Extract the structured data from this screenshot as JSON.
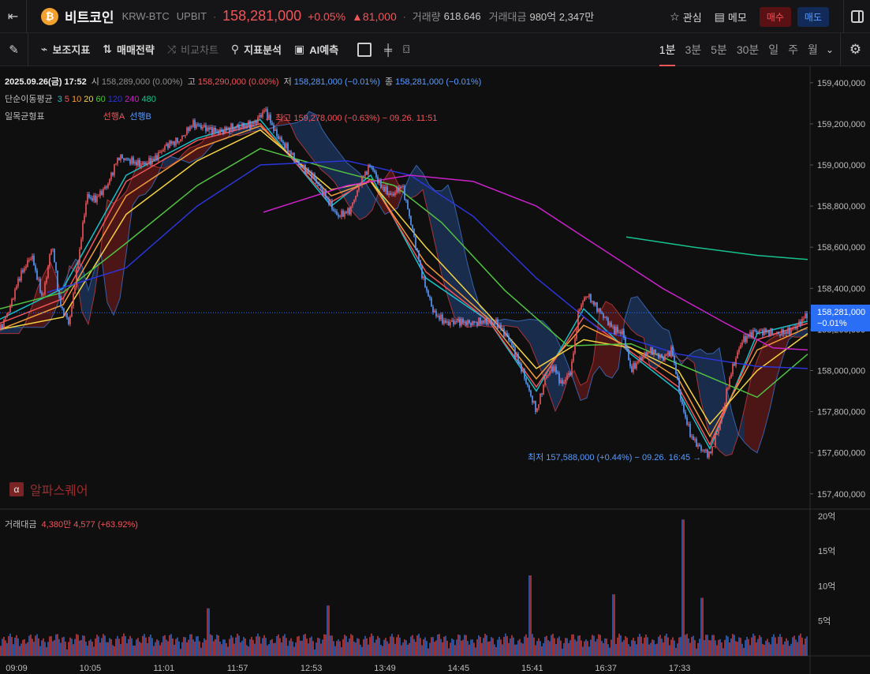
{
  "header": {
    "back_icon": "collapse-left-icon",
    "coin_logo": "₿",
    "coin_name": "비트코인",
    "pair": "KRW-BTC",
    "exchange": "UPBIT",
    "price": "158,281,000",
    "change_pct": "+0.05%",
    "change_amt": "▲81,000",
    "volume_label": "거래량",
    "volume_value": "618.646",
    "trade_value_label": "거래대금",
    "trade_value": "980억 2,347만",
    "watch_label": "관심",
    "memo_label": "메모",
    "buy_label": "매수",
    "sell_label": "매도"
  },
  "toolbar": {
    "indicators": "보조지표",
    "strategy": "매매전략",
    "compare": "비교차트",
    "analysis": "지표분석",
    "ai": "AI예측",
    "intervals": [
      "1분",
      "3분",
      "5분",
      "30분",
      "일",
      "주",
      "월"
    ],
    "active_interval": "1분"
  },
  "info": {
    "date": "2025.09.26(금) 17:52",
    "open_label": "시",
    "open": "158,289,000 (0.00%)",
    "high_label": "고",
    "high": "158,290,000 (0.00%)",
    "low_label": "저",
    "low": "158,281,000 (−0.01%)",
    "close_label": "종",
    "close": "158,281,000 (−0.01%)",
    "sma_label": "단순이동평균",
    "sma_periods": [
      "3",
      "5",
      "10",
      "20",
      "60",
      "120",
      "240",
      "480"
    ],
    "ichimoku_label": "일목균형표",
    "span_a": "선행A",
    "span_b": "선행B",
    "volume_label": "거래대금",
    "volume_text": "4,380만 4,577 (+63.92%)"
  },
  "annotations": {
    "high_text": "← 최고 159,278,000 (−0.63%) − 09.26. 11:51",
    "low_text": "최저 157,588,000 (+0.44%) − 09.26. 16:45 →"
  },
  "current_price_tag": {
    "price": "158,281,000",
    "pct": "−0.01%"
  },
  "watermark": {
    "logo": "α",
    "text": "알파스퀘어"
  },
  "colors": {
    "up": "#f0555a",
    "down": "#5b9bff",
    "sma": [
      "#16c1c9",
      "#f0555a",
      "#f09a3a",
      "#f5d442",
      "#51c241",
      "#2b35d8",
      "#c822c8",
      "#18c28f"
    ]
  },
  "chart_data": {
    "type": "line",
    "title": "",
    "x_ticks": [
      "09:09",
      "10:05",
      "11:01",
      "11:57",
      "12:53",
      "13:49",
      "14:45",
      "15:41",
      "16:37",
      "17:33"
    ],
    "price_ticks": [
      "159,400,000",
      "159,200,000",
      "159,000,000",
      "158,800,000",
      "158,600,000",
      "158,400,000",
      "158,200,000",
      "158,000,000",
      "157,800,000",
      "157,600,000",
      "157,400,000"
    ],
    "volume_ticks": [
      "20억",
      "15억",
      "10억",
      "5억"
    ],
    "ylim": [
      157330000,
      159480000
    ],
    "volume_ylim": [
      0,
      2100000000
    ],
    "price_series": {
      "name": "price",
      "points": [
        [
          0,
          158200000
        ],
        [
          12,
          158300000
        ],
        [
          24,
          158450000
        ],
        [
          40,
          158560000
        ],
        [
          54,
          158350000
        ],
        [
          66,
          158620000
        ],
        [
          76,
          158320000
        ],
        [
          88,
          158230000
        ],
        [
          100,
          158560000
        ],
        [
          110,
          158850000
        ],
        [
          120,
          158830000
        ],
        [
          136,
          158900000
        ],
        [
          150,
          159040000
        ],
        [
          166,
          159020000
        ],
        [
          180,
          159000000
        ],
        [
          196,
          159030000
        ],
        [
          212,
          159100000
        ],
        [
          228,
          159120000
        ],
        [
          244,
          159200000
        ],
        [
          260,
          159180000
        ],
        [
          276,
          159160000
        ],
        [
          292,
          159180000
        ],
        [
          308,
          159190000
        ],
        [
          322,
          159200000
        ],
        [
          336,
          159270000
        ],
        [
          350,
          159150000
        ],
        [
          364,
          159080000
        ],
        [
          380,
          159000000
        ],
        [
          396,
          158950000
        ],
        [
          412,
          158850000
        ],
        [
          428,
          158750000
        ],
        [
          444,
          158780000
        ],
        [
          458,
          158930000
        ],
        [
          470,
          159000000
        ],
        [
          482,
          158900000
        ],
        [
          496,
          158850000
        ],
        [
          510,
          158900000
        ],
        [
          522,
          158700000
        ],
        [
          536,
          158450000
        ],
        [
          550,
          158280000
        ],
        [
          566,
          158230000
        ],
        [
          580,
          158240000
        ],
        [
          596,
          158230000
        ],
        [
          612,
          158240000
        ],
        [
          630,
          158230000
        ],
        [
          646,
          158150000
        ],
        [
          662,
          158000000
        ],
        [
          680,
          157800000
        ],
        [
          692,
          157970000
        ],
        [
          702,
          158020000
        ],
        [
          712,
          157930000
        ],
        [
          724,
          158000000
        ],
        [
          734,
          158300000
        ],
        [
          744,
          158370000
        ],
        [
          756,
          158310000
        ],
        [
          766,
          158260000
        ],
        [
          778,
          158200000
        ],
        [
          790,
          158180000
        ],
        [
          800,
          158000000
        ],
        [
          812,
          158060000
        ],
        [
          826,
          158100000
        ],
        [
          840,
          158060000
        ],
        [
          852,
          158100000
        ],
        [
          864,
          157840000
        ],
        [
          876,
          157680000
        ],
        [
          888,
          157620000
        ],
        [
          900,
          157590000
        ],
        [
          912,
          157730000
        ],
        [
          926,
          157980000
        ],
        [
          940,
          158140000
        ],
        [
          956,
          158190000
        ],
        [
          972,
          158190000
        ],
        [
          986,
          158180000
        ],
        [
          1000,
          158190000
        ],
        [
          1012,
          158220000
        ],
        [
          1024,
          158281000
        ]
      ]
    },
    "sma_series": [
      {
        "name": "3",
        "points": [
          [
            0,
            158250000
          ],
          [
            80,
            158400000
          ],
          [
            160,
            158950000
          ],
          [
            250,
            159130000
          ],
          [
            330,
            159220000
          ],
          [
            420,
            158800000
          ],
          [
            470,
            158950000
          ],
          [
            540,
            158450000
          ],
          [
            620,
            158240000
          ],
          [
            680,
            157900000
          ],
          [
            740,
            158300000
          ],
          [
            800,
            158080000
          ],
          [
            860,
            157900000
          ],
          [
            900,
            157620000
          ],
          [
            960,
            158180000
          ],
          [
            1024,
            158240000
          ]
        ]
      },
      {
        "name": "5",
        "points": [
          [
            0,
            158230000
          ],
          [
            80,
            158350000
          ],
          [
            160,
            158920000
          ],
          [
            250,
            159120000
          ],
          [
            330,
            159200000
          ],
          [
            420,
            158820000
          ],
          [
            470,
            158930000
          ],
          [
            540,
            158480000
          ],
          [
            620,
            158240000
          ],
          [
            680,
            157920000
          ],
          [
            740,
            158260000
          ],
          [
            800,
            158090000
          ],
          [
            860,
            157920000
          ],
          [
            900,
            157640000
          ],
          [
            960,
            158150000
          ],
          [
            1024,
            158230000
          ]
        ]
      },
      {
        "name": "10",
        "points": [
          [
            0,
            158200000
          ],
          [
            80,
            158320000
          ],
          [
            160,
            158850000
          ],
          [
            250,
            159080000
          ],
          [
            330,
            159190000
          ],
          [
            420,
            158850000
          ],
          [
            470,
            158920000
          ],
          [
            540,
            158520000
          ],
          [
            620,
            158250000
          ],
          [
            680,
            157960000
          ],
          [
            740,
            158220000
          ],
          [
            800,
            158110000
          ],
          [
            860,
            157960000
          ],
          [
            900,
            157680000
          ],
          [
            960,
            158100000
          ],
          [
            1024,
            158210000
          ]
        ]
      },
      {
        "name": "20",
        "points": [
          [
            0,
            158200000
          ],
          [
            80,
            158260000
          ],
          [
            160,
            158760000
          ],
          [
            250,
            159020000
          ],
          [
            330,
            159170000
          ],
          [
            420,
            158880000
          ],
          [
            470,
            158920000
          ],
          [
            540,
            158600000
          ],
          [
            620,
            158270000
          ],
          [
            680,
            158010000
          ],
          [
            740,
            158150000
          ],
          [
            800,
            158110000
          ],
          [
            860,
            158000000
          ],
          [
            900,
            157740000
          ],
          [
            960,
            158000000
          ],
          [
            1024,
            158180000
          ]
        ]
      },
      {
        "name": "60",
        "points": [
          [
            0,
            158300000
          ],
          [
            80,
            158380000
          ],
          [
            160,
            158620000
          ],
          [
            250,
            158900000
          ],
          [
            330,
            159080000
          ],
          [
            420,
            158980000
          ],
          [
            500,
            158900000
          ],
          [
            560,
            158720000
          ],
          [
            640,
            158390000
          ],
          [
            720,
            158120000
          ],
          [
            800,
            158130000
          ],
          [
            880,
            158000000
          ],
          [
            960,
            157870000
          ],
          [
            1024,
            158080000
          ]
        ]
      },
      {
        "name": "120",
        "points": [
          [
            60,
            158380000
          ],
          [
            160,
            158500000
          ],
          [
            250,
            158800000
          ],
          [
            330,
            159000000
          ],
          [
            440,
            159020000
          ],
          [
            520,
            158950000
          ],
          [
            600,
            158750000
          ],
          [
            680,
            158450000
          ],
          [
            760,
            158200000
          ],
          [
            860,
            158080000
          ],
          [
            960,
            158020000
          ],
          [
            1024,
            158010000
          ]
        ]
      },
      {
        "name": "240",
        "points": [
          [
            334,
            158770000
          ],
          [
            440,
            158900000
          ],
          [
            520,
            158950000
          ],
          [
            600,
            158920000
          ],
          [
            680,
            158800000
          ],
          [
            760,
            158600000
          ],
          [
            840,
            158400000
          ],
          [
            920,
            158230000
          ],
          [
            980,
            158110000
          ],
          [
            1024,
            158100000
          ]
        ]
      },
      {
        "name": "480",
        "points": [
          [
            794,
            158650000
          ],
          [
            880,
            158600000
          ],
          [
            960,
            158560000
          ],
          [
            1024,
            158540000
          ]
        ]
      }
    ],
    "volume": {
      "peaks": [
        [
          264,
          680000000
        ],
        [
          416,
          720000000
        ],
        [
          672,
          1150000000
        ],
        [
          778,
          880000000
        ],
        [
          866,
          1950000000
        ],
        [
          890,
          830000000
        ]
      ]
    }
  }
}
